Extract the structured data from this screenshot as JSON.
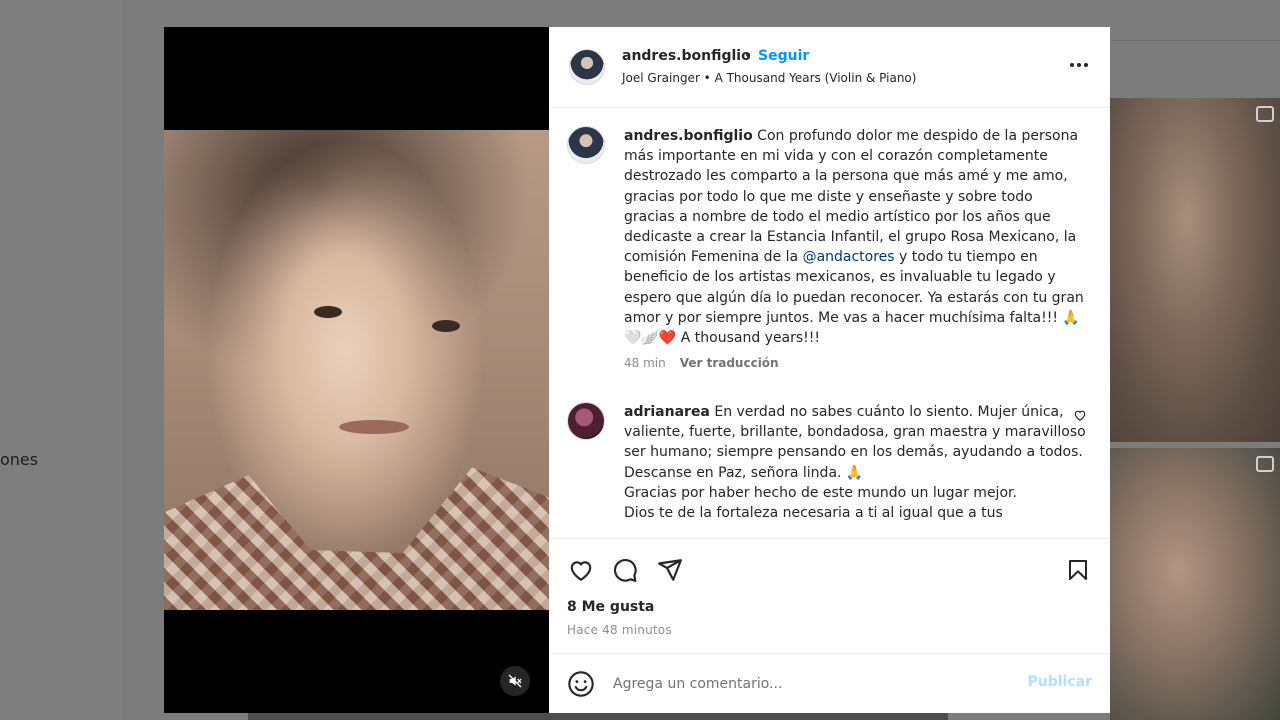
{
  "background": {
    "sidebar_partial_text": "ones"
  },
  "post": {
    "username": "andres.bonfiglio",
    "separator": "•",
    "follow_label": "Seguir",
    "audio": "Joel Grainger • A Thousand Years (Violin & Piano)",
    "caption": {
      "username": "andres.bonfiglio",
      "text_before_mention": "Con profundo dolor me despido de la persona más importante en mi vida y con el corazón completamente destrozado les comparto a la persona que más amé y me amo, gracias por todo lo que me diste y enseñaste y sobre todo gracias a nombre de todo el medio artístico por los años que dedicaste a crear la Estancia Infantil, el grupo Rosa Mexicano, la comisión Femenina de la",
      "mention": "@andactores",
      "text_after_mention": "y todo tu tiempo en beneficio de los artistas mexicanos, es invaluable tu legado y espero que algún día lo puedan reconocer. Ya estarás con tu gran amor y por siempre juntos. Me vas a hacer muchísima falta!!! 🙏🤍🪽❤️ A thousand years!!!",
      "time": "48 min",
      "translate_label": "Ver traducción"
    },
    "comments": [
      {
        "username": "adrianarea",
        "lines": [
          "En verdad no sabes cuánto lo siento. Mujer única, valiente, fuerte, brillante, bondadosa, gran maestra y maravilloso ser humano; siempre pensando en los demás, ayudando a todos.",
          "Descanse en Paz, señora linda. 🙏",
          "Gracias por haber hecho de este mundo un lugar mejor.",
          "Dios te de la fortaleza necesaria a ti al igual que a tus"
        ]
      }
    ],
    "likes": "8 Me gusta",
    "posted_ago": "Hace 48 minutos",
    "comment_placeholder": "Agrega un comentario...",
    "publish_label": "Publicar"
  },
  "icons": {
    "more": "more-options-icon",
    "like": "heart-icon",
    "comment": "comment-icon",
    "share": "share-icon",
    "save": "bookmark-icon",
    "emoji": "emoji-icon",
    "mute": "muted-speaker-icon"
  },
  "colors": {
    "accent": "#0095f6",
    "mention": "#00376b",
    "muted_text": "#8e8e8e",
    "publish_disabled": "#b2dffc"
  }
}
